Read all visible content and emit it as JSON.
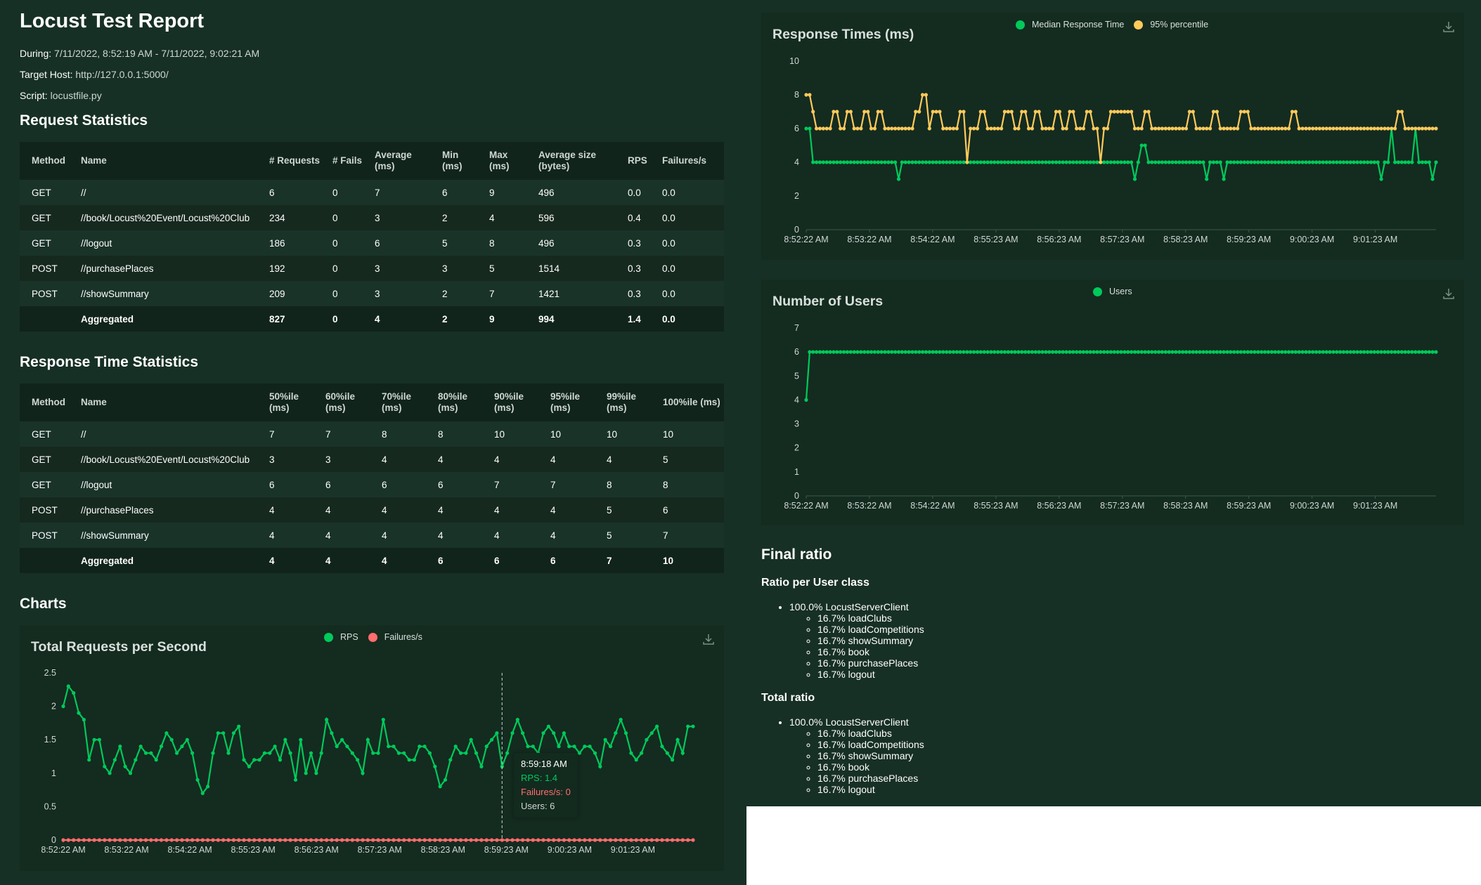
{
  "report": {
    "title": "Locust Test Report",
    "during_label": "During:",
    "during_value": "7/11/2022, 8:52:19 AM - 7/11/2022, 9:02:21 AM",
    "host_label": "Target Host:",
    "host_value": "http://127.0.0.1:5000/",
    "script_label": "Script:",
    "script_value": "locustfile.py"
  },
  "request_stats": {
    "title": "Request Statistics",
    "headers": [
      "Method",
      "Name",
      "# Requests",
      "# Fails",
      "Average (ms)",
      "Min (ms)",
      "Max (ms)",
      "Average size (bytes)",
      "RPS",
      "Failures/s"
    ],
    "rows": [
      [
        "GET",
        "//",
        "6",
        "0",
        "7",
        "6",
        "9",
        "496",
        "0.0",
        "0.0"
      ],
      [
        "GET",
        "//book/Locust%20Event/Locust%20Club",
        "234",
        "0",
        "3",
        "2",
        "4",
        "596",
        "0.4",
        "0.0"
      ],
      [
        "GET",
        "//logout",
        "186",
        "0",
        "6",
        "5",
        "8",
        "496",
        "0.3",
        "0.0"
      ],
      [
        "POST",
        "//purchasePlaces",
        "192",
        "0",
        "3",
        "3",
        "5",
        "1514",
        "0.3",
        "0.0"
      ],
      [
        "POST",
        "//showSummary",
        "209",
        "0",
        "3",
        "2",
        "7",
        "1421",
        "0.3",
        "0.0"
      ],
      [
        "",
        "Aggregated",
        "827",
        "0",
        "4",
        "2",
        "9",
        "994",
        "1.4",
        "0.0"
      ]
    ]
  },
  "response_time_stats": {
    "title": "Response Time Statistics",
    "headers": [
      "Method",
      "Name",
      "50%ile (ms)",
      "60%ile (ms)",
      "70%ile (ms)",
      "80%ile (ms)",
      "90%ile (ms)",
      "95%ile (ms)",
      "99%ile (ms)",
      "100%ile (ms)"
    ],
    "rows": [
      [
        "GET",
        "//",
        "7",
        "7",
        "8",
        "8",
        "10",
        "10",
        "10",
        "10"
      ],
      [
        "GET",
        "//book/Locust%20Event/Locust%20Club",
        "3",
        "3",
        "4",
        "4",
        "4",
        "4",
        "4",
        "5"
      ],
      [
        "GET",
        "//logout",
        "6",
        "6",
        "6",
        "6",
        "7",
        "7",
        "8",
        "8"
      ],
      [
        "POST",
        "//purchasePlaces",
        "4",
        "4",
        "4",
        "4",
        "4",
        "4",
        "5",
        "6"
      ],
      [
        "POST",
        "//showSummary",
        "4",
        "4",
        "4",
        "4",
        "4",
        "4",
        "5",
        "7"
      ],
      [
        "",
        "Aggregated",
        "4",
        "4",
        "4",
        "6",
        "6",
        "6",
        "7",
        "10"
      ]
    ]
  },
  "charts_heading": "Charts",
  "tooltip": {
    "time": "8:59:18 AM",
    "rps": "RPS: 1.4",
    "failures": "Failures/s: 0",
    "users": "Users: 6"
  },
  "final_ratio": {
    "title": "Final ratio",
    "per_class_title": "Ratio per User class",
    "total_title": "Total ratio",
    "per_class": {
      "top": "100.0% LocustServerClient",
      "items": [
        "16.7% loadClubs",
        "16.7% loadCompetitions",
        "16.7% showSummary",
        "16.7% book",
        "16.7% purchasePlaces",
        "16.7% logout"
      ]
    },
    "total": {
      "top": "100.0% LocustServerClient",
      "items": [
        "16.7% loadClubs",
        "16.7% loadCompetitions",
        "16.7% showSummary",
        "16.7% book",
        "16.7% purchasePlaces",
        "16.7% logout"
      ]
    }
  },
  "colors": {
    "background": "#173025",
    "panel": "#142b20",
    "green": "#00ca5a",
    "yellow": "#ffca5a",
    "red": "#ff6d6d",
    "grid": "#2f4a3d"
  },
  "chart_data": [
    {
      "id": "rps",
      "type": "line",
      "title": "Total Requests per Second",
      "ylim": [
        0,
        2.5
      ],
      "yticks": [
        0,
        0.5,
        1,
        1.5,
        2,
        2.5
      ],
      "xticks": [
        "8:52:22 AM",
        "8:53:22 AM",
        "8:54:22 AM",
        "8:55:23 AM",
        "8:56:23 AM",
        "8:57:23 AM",
        "8:58:23 AM",
        "8:59:23 AM",
        "9:00:23 AM",
        "9:01:23 AM"
      ],
      "legend_position": "top-center",
      "series": [
        {
          "name": "RPS",
          "color": "#00ca5a",
          "values": [
            2,
            2.3,
            2.2,
            1.9,
            1.8,
            1.2,
            1.5,
            1.5,
            1.1,
            1,
            1.2,
            1.4,
            1.1,
            1,
            1.2,
            1.4,
            1.3,
            1.3,
            1.2,
            1.4,
            1.6,
            1.5,
            1.3,
            1.4,
            1.5,
            1.3,
            0.9,
            0.7,
            0.8,
            1.3,
            1.6,
            1.6,
            1.3,
            1.6,
            1.7,
            1.2,
            1.1,
            1.2,
            1.2,
            1.3,
            1.3,
            1.4,
            1.2,
            1.5,
            1.3,
            0.9,
            1.5,
            1,
            1.3,
            1,
            1.3,
            1.8,
            1.6,
            1.4,
            1.5,
            1.4,
            1.3,
            1.2,
            1,
            1.5,
            1.3,
            1.3,
            1.8,
            1.4,
            1.4,
            1.3,
            1.3,
            1.2,
            1.2,
            1.4,
            1.4,
            1.3,
            1.1,
            0.8,
            0.9,
            1.2,
            1.4,
            1.3,
            1.3,
            1.5,
            1.3,
            1.1,
            1.4,
            1.5,
            1.6,
            1.1,
            1.3,
            1.6,
            1.8,
            1.6,
            1.4,
            1.4,
            1.3,
            1.6,
            1.7,
            1.6,
            1.4,
            1.6,
            1.4,
            1.4,
            1.3,
            1.4,
            1.4,
            1.3,
            1.1,
            1.5,
            1.4,
            1.6,
            1.8,
            1.6,
            1.3,
            1.2,
            1.3,
            1.5,
            1.6,
            1.7,
            1.4,
            1.3,
            1.2,
            1.5,
            1.3,
            1.7,
            1.7
          ]
        },
        {
          "name": "Failures/s",
          "color": "#ff6d6d",
          "values": [
            0,
            0,
            0,
            0,
            0,
            0,
            0,
            0,
            0,
            0,
            0,
            0,
            0,
            0,
            0,
            0,
            0,
            0,
            0,
            0,
            0,
            0,
            0,
            0,
            0,
            0,
            0,
            0,
            0,
            0,
            0,
            0,
            0,
            0,
            0,
            0,
            0,
            0,
            0,
            0,
            0,
            0,
            0,
            0,
            0,
            0,
            0,
            0,
            0,
            0,
            0,
            0,
            0,
            0,
            0,
            0,
            0,
            0,
            0,
            0,
            0,
            0,
            0,
            0,
            0,
            0,
            0,
            0,
            0,
            0,
            0,
            0,
            0,
            0,
            0,
            0,
            0,
            0,
            0,
            0,
            0,
            0,
            0,
            0,
            0,
            0,
            0,
            0,
            0,
            0,
            0,
            0,
            0,
            0,
            0,
            0,
            0,
            0,
            0,
            0,
            0,
            0,
            0,
            0,
            0,
            0,
            0,
            0,
            0,
            0,
            0,
            0,
            0,
            0,
            0,
            0,
            0,
            0,
            0,
            0,
            0,
            0,
            0
          ]
        }
      ]
    },
    {
      "id": "response_times",
      "type": "line",
      "title": "Response Times (ms)",
      "ylim": [
        0,
        10
      ],
      "yticks": [
        0,
        2,
        4,
        6,
        8,
        10
      ],
      "xticks": [
        "8:52:22 AM",
        "8:53:22 AM",
        "8:54:22 AM",
        "8:55:23 AM",
        "8:56:23 AM",
        "8:57:23 AM",
        "8:58:23 AM",
        "8:59:23 AM",
        "9:00:23 AM",
        "9:01:23 AM"
      ],
      "legend_position": "top-center",
      "series": [
        {
          "name": "Median Response Time",
          "color": "#00ca5a",
          "values": [
            6,
            6,
            4,
            4,
            4,
            4,
            4,
            4,
            4,
            4,
            4,
            4,
            4,
            4,
            4,
            4,
            4,
            4,
            4,
            4,
            4,
            4,
            4,
            4,
            4,
            4,
            4,
            3,
            4,
            4,
            4,
            4,
            4,
            4,
            4,
            4,
            4,
            4,
            4,
            4,
            4,
            4,
            4,
            4,
            4,
            4,
            4,
            4,
            4,
            4,
            4,
            4,
            4,
            4,
            4,
            4,
            4,
            4,
            4,
            4,
            4,
            4,
            4,
            4,
            4,
            4,
            4,
            4,
            4,
            4,
            4,
            4,
            4,
            4,
            4,
            4,
            4,
            4,
            4,
            4,
            4,
            4,
            4,
            4,
            4,
            4,
            4,
            4,
            4,
            4,
            4,
            4,
            4,
            4,
            4,
            4,
            3,
            4,
            5,
            5,
            4,
            4,
            4,
            4,
            4,
            4,
            4,
            4,
            4,
            4,
            4,
            4,
            4,
            4,
            4,
            4,
            4,
            3,
            4,
            4,
            4,
            4,
            3,
            4,
            4,
            4,
            4,
            4,
            4,
            4,
            4,
            4,
            4,
            4,
            4,
            4,
            4,
            4,
            4,
            4,
            4,
            4,
            4,
            4,
            4,
            4,
            4,
            4,
            4,
            4,
            4,
            4,
            4,
            4,
            4,
            4,
            4,
            4,
            4,
            4,
            4,
            4,
            4,
            4,
            4,
            4,
            4,
            4,
            3,
            4,
            4,
            6,
            4,
            4,
            4,
            4,
            4,
            4,
            6,
            4,
            4,
            4,
            4,
            3,
            4
          ]
        },
        {
          "name": "95% percentile",
          "color": "#ffca5a",
          "values": [
            8,
            8,
            7,
            6,
            6,
            6,
            6,
            6,
            7,
            7,
            6,
            6,
            7,
            7,
            6,
            6,
            6,
            7,
            7,
            6,
            6,
            7,
            7,
            6,
            6,
            6,
            6,
            6,
            6,
            6,
            6,
            6,
            7,
            7,
            8,
            8,
            6,
            7,
            7,
            7,
            6,
            6,
            6,
            6,
            6,
            7,
            7,
            4,
            6,
            6,
            6,
            7,
            7,
            6,
            6,
            6,
            6,
            6,
            7,
            7,
            7,
            6,
            6,
            7,
            7,
            6,
            6,
            7,
            7,
            6,
            6,
            6,
            6,
            7,
            7,
            6,
            6,
            7,
            7,
            6,
            6,
            6,
            7,
            7,
            6,
            6,
            4,
            6,
            6,
            7,
            7,
            7,
            7,
            7,
            7,
            7,
            6,
            6,
            6,
            7,
            7,
            6,
            6,
            6,
            6,
            6,
            6,
            6,
            6,
            6,
            6,
            6,
            7,
            7,
            6,
            6,
            6,
            6,
            6,
            7,
            7,
            6,
            6,
            6,
            6,
            6,
            6,
            7,
            7,
            7,
            6,
            6,
            6,
            6,
            6,
            6,
            6,
            6,
            6,
            6,
            6,
            6,
            7,
            7,
            6,
            6,
            6,
            6,
            6,
            6,
            6,
            6,
            6,
            6,
            6,
            6,
            6,
            6,
            6,
            6,
            6,
            6,
            6,
            6,
            6,
            6,
            6,
            6,
            6,
            6,
            6,
            6,
            6,
            7,
            7,
            6,
            6,
            6,
            6,
            6,
            6,
            6,
            6,
            6,
            6
          ]
        }
      ]
    },
    {
      "id": "users",
      "type": "line",
      "title": "Number of Users",
      "ylim": [
        0,
        7
      ],
      "yticks": [
        0,
        1,
        2,
        3,
        4,
        5,
        6,
        7
      ],
      "xticks": [
        "8:52:22 AM",
        "8:53:22 AM",
        "8:54:22 AM",
        "8:55:23 AM",
        "8:56:23 AM",
        "8:57:23 AM",
        "8:58:23 AM",
        "8:59:23 AM",
        "9:00:23 AM",
        "9:01:23 AM"
      ],
      "legend_position": "top-center",
      "series": [
        {
          "name": "Users",
          "color": "#00ca5a",
          "values": [
            4,
            6,
            6,
            6,
            6,
            6,
            6,
            6,
            6,
            6,
            6,
            6,
            6,
            6,
            6,
            6,
            6,
            6,
            6,
            6,
            6,
            6,
            6,
            6,
            6,
            6,
            6,
            6,
            6,
            6,
            6,
            6,
            6,
            6,
            6,
            6,
            6,
            6,
            6,
            6,
            6,
            6,
            6,
            6,
            6,
            6,
            6,
            6,
            6,
            6,
            6,
            6,
            6,
            6,
            6,
            6,
            6,
            6,
            6,
            6,
            6,
            6,
            6,
            6,
            6,
            6,
            6,
            6,
            6,
            6,
            6,
            6,
            6,
            6,
            6,
            6,
            6,
            6,
            6,
            6,
            6,
            6,
            6,
            6,
            6,
            6,
            6,
            6,
            6,
            6,
            6,
            6,
            6,
            6,
            6,
            6,
            6,
            6,
            6,
            6,
            6,
            6,
            6,
            6,
            6,
            6,
            6,
            6,
            6,
            6,
            6,
            6,
            6,
            6,
            6,
            6,
            6,
            6,
            6,
            6,
            6,
            6,
            6,
            6,
            6,
            6,
            6,
            6,
            6,
            6,
            6,
            6,
            6,
            6,
            6,
            6,
            6,
            6,
            6,
            6,
            6,
            6,
            6,
            6,
            6,
            6,
            6,
            6,
            6,
            6,
            6,
            6,
            6,
            6,
            6,
            6,
            6,
            6,
            6,
            6,
            6,
            6,
            6,
            6,
            6,
            6,
            6,
            6,
            6,
            6,
            6,
            6,
            6,
            6,
            6,
            6,
            6,
            6,
            6,
            6,
            6,
            6,
            6,
            6,
            6
          ]
        }
      ]
    }
  ]
}
